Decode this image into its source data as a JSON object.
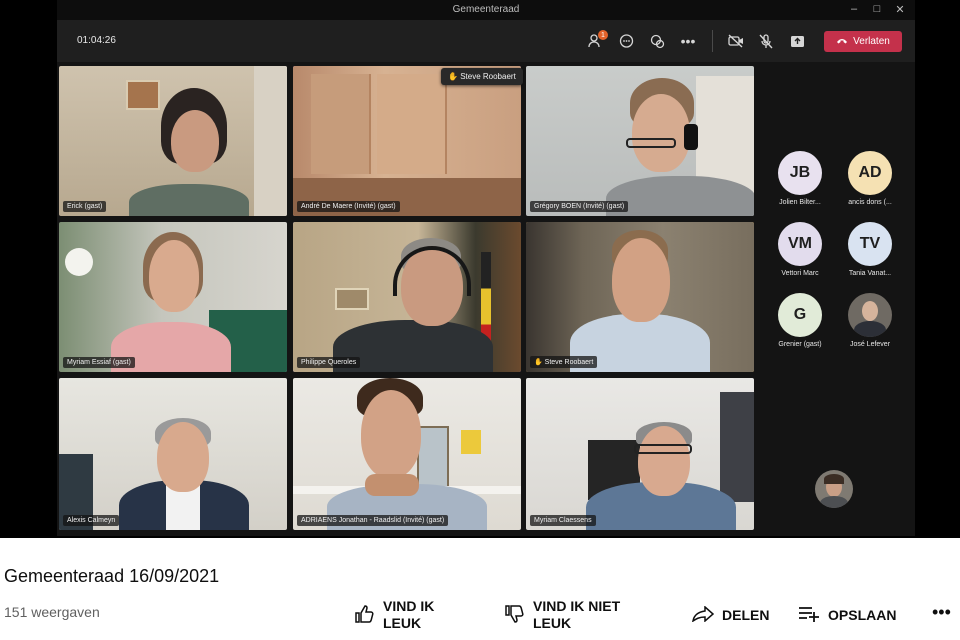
{
  "window": {
    "title": "Gemeenteraad"
  },
  "call": {
    "timer": "01:04:26",
    "leave_label": "Verlaten",
    "participant_badge": "1",
    "hand_raised_banner": "Steve Roobaert"
  },
  "participants": [
    {
      "name": "Erick (gast)"
    },
    {
      "name": "André De Maere (Invité) (gast)"
    },
    {
      "name": "Grégory BOEN (Invité) (gast)"
    },
    {
      "name": "Myriam Essiaf (gast)"
    },
    {
      "name": "Philippe Queroles"
    },
    {
      "name": "Steve Roobaert"
    },
    {
      "name": "Alexis Calmeyn"
    },
    {
      "name": "ADRIAENS Jonathan - Raadslid (Invité) (gast)"
    },
    {
      "name": "Myriam Claessens"
    }
  ],
  "roster": [
    {
      "initials": "JB",
      "name": "Jolien Bilter...",
      "color": "#e8e1ef"
    },
    {
      "initials": "AD",
      "name": "ancis dons (...",
      "color": "#f5e1b3"
    },
    {
      "initials": "VM",
      "name": "Vettori Marc",
      "color": "#e2dced"
    },
    {
      "initials": "TV",
      "name": "Tania Vanat...",
      "color": "#d9e3f1"
    },
    {
      "initials": "G",
      "name": "Grenier (gast)",
      "color": "#e1ebd8"
    },
    {
      "initials": "",
      "name": "José Lefever",
      "color": "#6f6a63"
    }
  ],
  "video": {
    "title": "Gemeenteraad 16/09/2021",
    "views": "151 weergaven",
    "like_label_1": "VIND IK",
    "like_label_2": "LEUK",
    "dislike_label_1": "VIND IK NIET",
    "dislike_label_2": "LEUK",
    "share_label": "DELEN",
    "save_label": "OPSLAAN"
  },
  "colors": {
    "leave": "#c4314b",
    "speaking": "#6b6fd6",
    "hand_raised": "#e6b34a",
    "teams_bg": "#141414"
  },
  "icons": [
    "participants-icon",
    "chat-icon",
    "reactions-icon",
    "more-icon",
    "camera-off-icon",
    "mic-off-icon",
    "share-tray-icon",
    "phone-icon",
    "like-icon",
    "dislike-icon",
    "share-icon",
    "save-playlist-icon",
    "more-actions-icon",
    "raised-hand-icon",
    "mic-muted-icon"
  ]
}
